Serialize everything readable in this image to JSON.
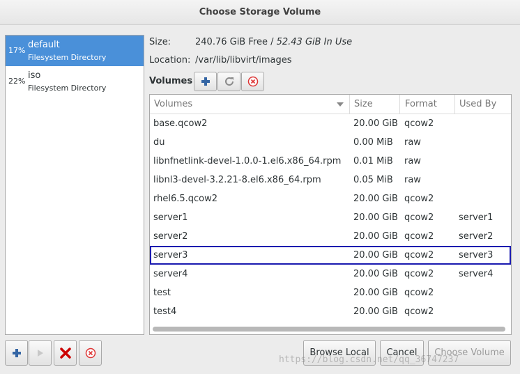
{
  "window": {
    "title": "Choose Storage Volume"
  },
  "pools": [
    {
      "usage": "17%",
      "name": "default",
      "type": "Filesystem Directory",
      "selected": true
    },
    {
      "usage": "22%",
      "name": "iso",
      "type": "Filesystem Directory",
      "selected": false
    }
  ],
  "info": {
    "size_label": "Size:",
    "size_free": "240.76 GiB Free / ",
    "size_inuse": "52.43 GiB In Use",
    "location_label": "Location:",
    "location_value": "/var/lib/libvirt/images"
  },
  "volumes_toolbar": {
    "label": "Volumes"
  },
  "volumes_table": {
    "columns": [
      "Volumes",
      "Size",
      "Format",
      "Used By"
    ],
    "rows": [
      {
        "name": "base.qcow2",
        "size": "20.00 GiB",
        "format": "qcow2",
        "used_by": ""
      },
      {
        "name": "du",
        "size": "0.00 MiB",
        "format": "raw",
        "used_by": ""
      },
      {
        "name": "libnfnetlink-devel-1.0.0-1.el6.x86_64.rpm",
        "size": "0.01 MiB",
        "format": "raw",
        "used_by": ""
      },
      {
        "name": "libnl3-devel-3.2.21-8.el6.x86_64.rpm",
        "size": "0.05 MiB",
        "format": "raw",
        "used_by": ""
      },
      {
        "name": "rhel6.5.qcow2",
        "size": "20.00 GiB",
        "format": "qcow2",
        "used_by": ""
      },
      {
        "name": "server1",
        "size": "20.00 GiB",
        "format": "qcow2",
        "used_by": "server1"
      },
      {
        "name": "server2",
        "size": "20.00 GiB",
        "format": "qcow2",
        "used_by": "server2"
      },
      {
        "name": "server3",
        "size": "20.00 GiB",
        "format": "qcow2",
        "used_by": "server3",
        "selected": true
      },
      {
        "name": "server4",
        "size": "20.00 GiB",
        "format": "qcow2",
        "used_by": "server4"
      },
      {
        "name": "test",
        "size": "20.00 GiB",
        "format": "qcow2",
        "used_by": ""
      },
      {
        "name": "test4",
        "size": "20.00 GiB",
        "format": "qcow2",
        "used_by": ""
      }
    ]
  },
  "buttons": {
    "browse_local": "Browse Local",
    "cancel": "Cancel",
    "choose_volume": "Choose Volume"
  },
  "watermark": "https://blog.csdn.net/qq_36747237",
  "colors": {
    "selection": "#4a90d9",
    "selected_row_outline": "#1a1ab0",
    "delete_red": "#cc0000"
  }
}
